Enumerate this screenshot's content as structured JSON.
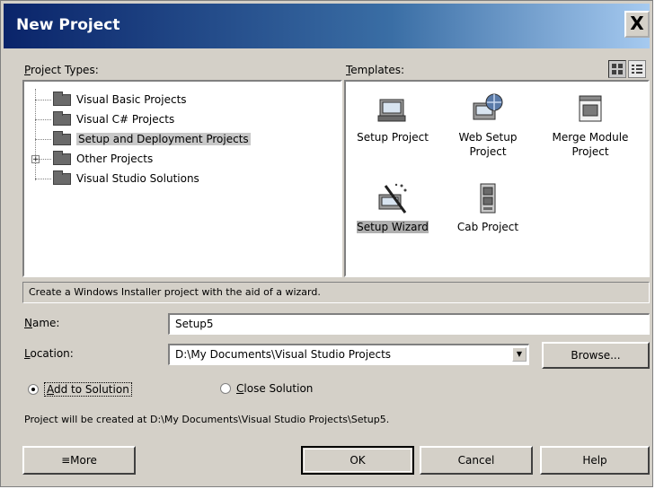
{
  "window": {
    "title": "New Project",
    "close_label": "X"
  },
  "project_types": {
    "label": "Project Types:",
    "items": [
      {
        "label": "Visual Basic Projects"
      },
      {
        "label": "Visual C# Projects"
      },
      {
        "label": "Setup and Deployment Projects",
        "selected": true
      },
      {
        "label": "Other Projects",
        "expander": "+"
      },
      {
        "label": "Visual Studio Solutions"
      }
    ]
  },
  "templates": {
    "label": "Templates:",
    "items": [
      {
        "label": "Setup Project",
        "icon": "setup-project-icon"
      },
      {
        "label": "Web Setup Project",
        "icon": "web-setup-project-icon"
      },
      {
        "label": "Merge Module Project",
        "icon": "merge-module-project-icon"
      },
      {
        "label": "Setup Wizard",
        "icon": "setup-wizard-icon",
        "selected": true
      },
      {
        "label": "Cab Project",
        "icon": "cab-project-icon"
      }
    ]
  },
  "description": "Create a Windows Installer project with the aid of a wizard.",
  "name": {
    "label": "Name:",
    "value": "Setup5"
  },
  "location": {
    "label": "Location:",
    "value": "D:\\My Documents\\Visual Studio Projects",
    "browse_label": "Browse..."
  },
  "solution": {
    "add_label": "Add to Solution",
    "close_label": "Close Solution",
    "selected": "add"
  },
  "project_path": "Project will be created at D:\\My Documents\\Visual Studio Projects\\Setup5.",
  "buttons": {
    "more": "≡More",
    "ok": "OK",
    "cancel": "Cancel",
    "help": "Help"
  }
}
